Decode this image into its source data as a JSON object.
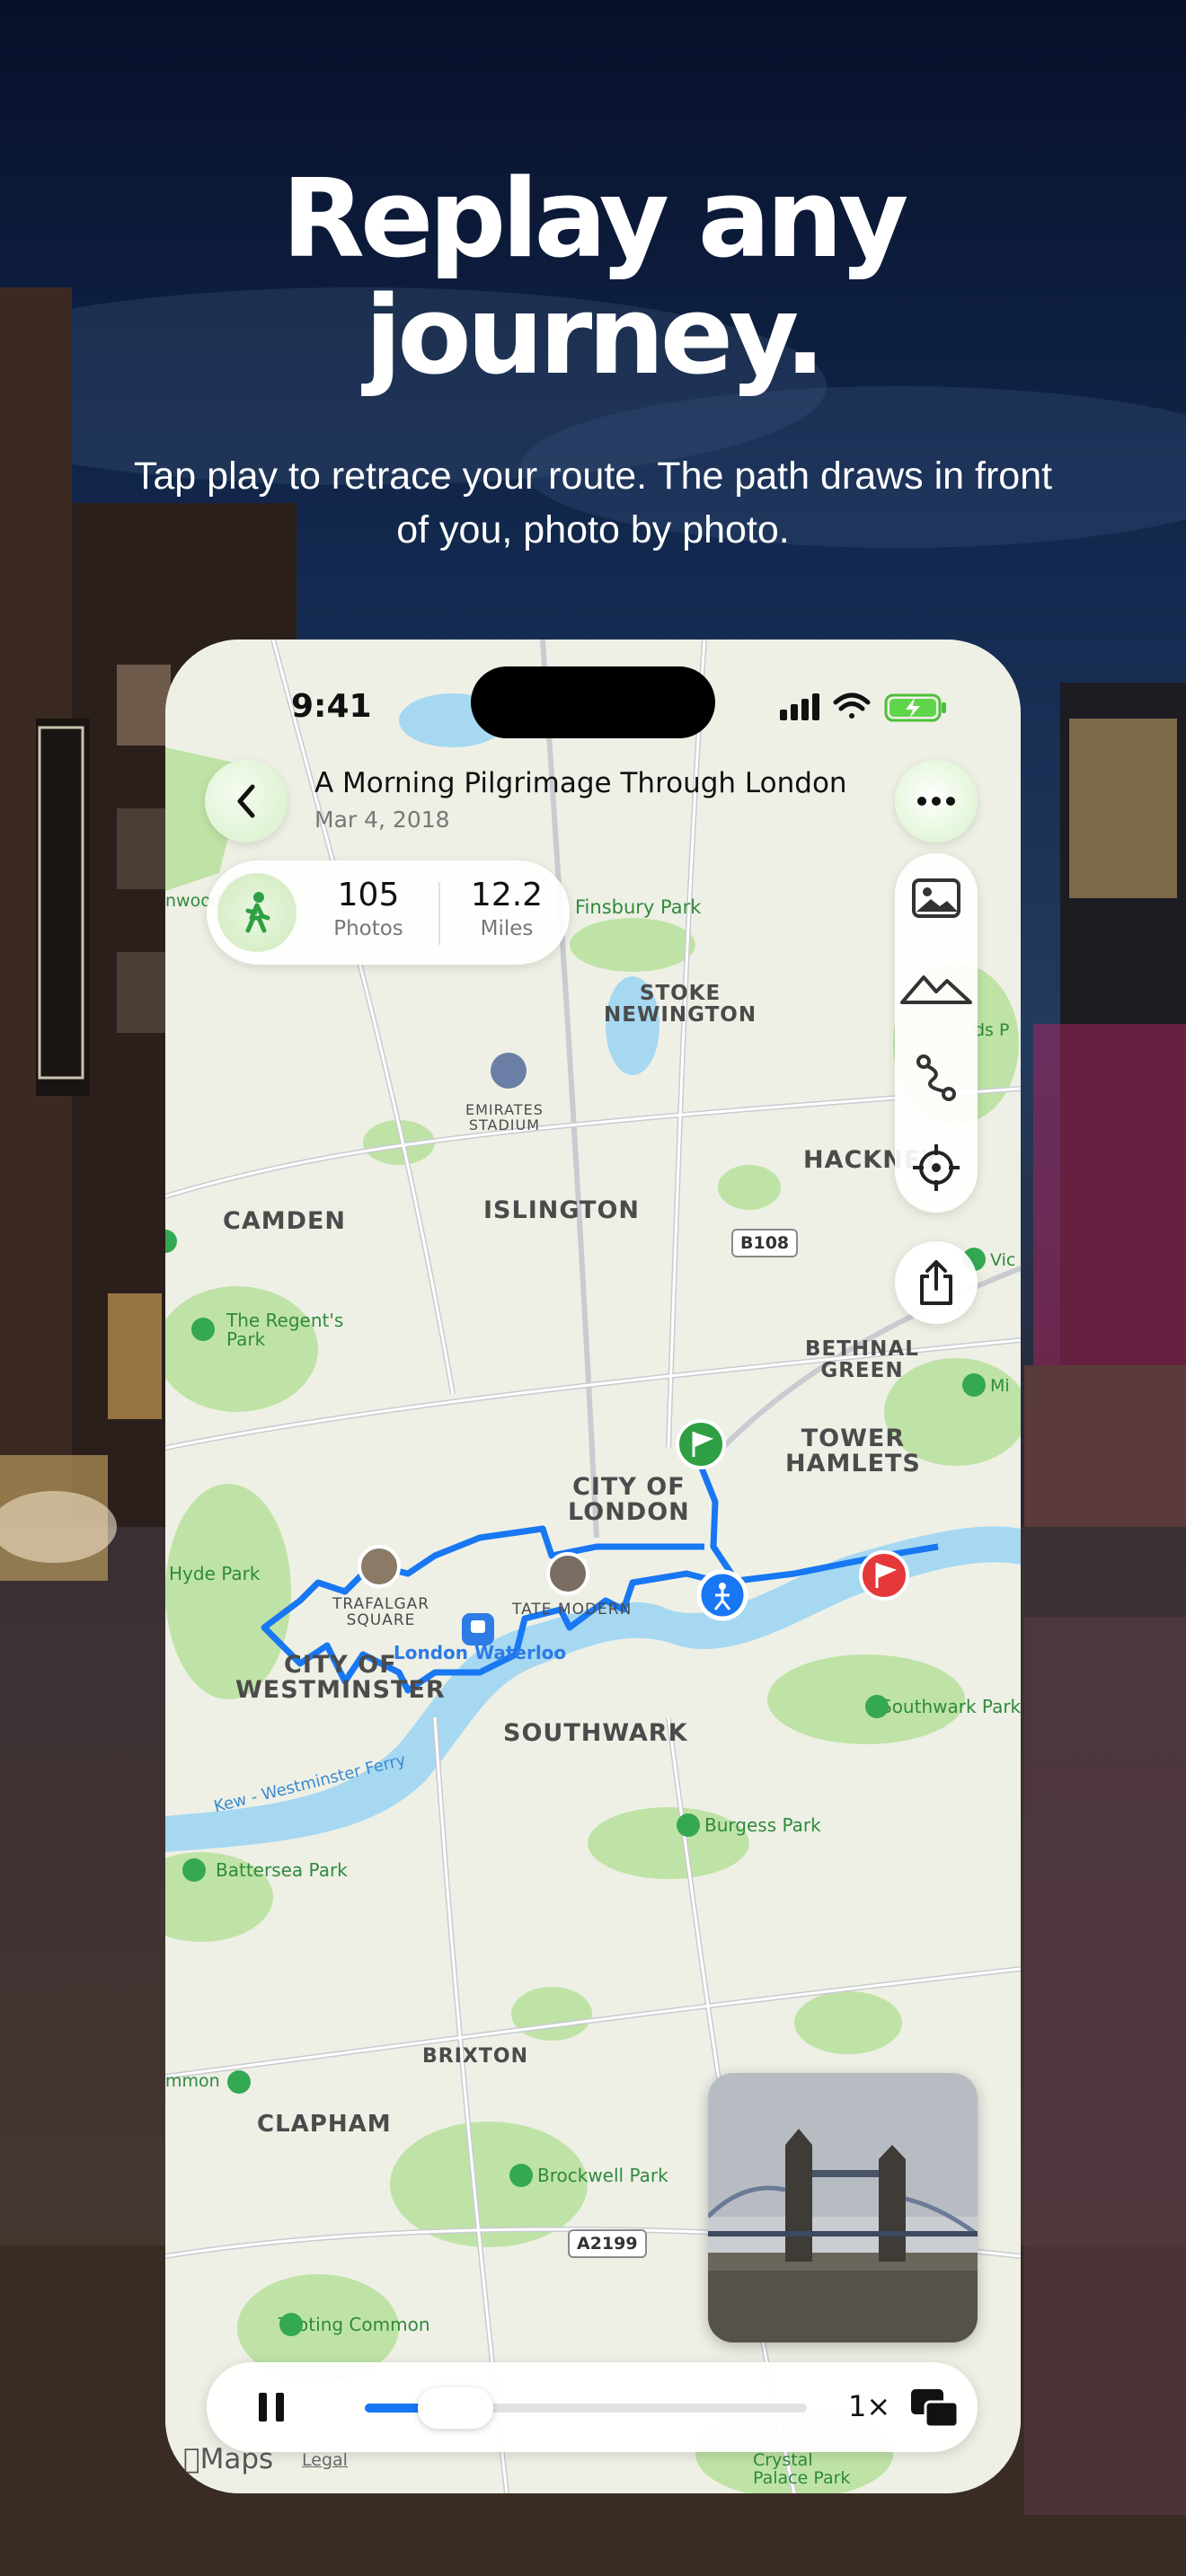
{
  "headline": {
    "line1": "Replay any",
    "line2": "journey."
  },
  "subhead": {
    "line1": "Tap play to retrace your route. The path draws in front",
    "line2": "of you, photo by photo."
  },
  "status_bar": {
    "time": "9:41"
  },
  "journey": {
    "title": "A Morning Pilgrimage Through London",
    "date": "Mar 4, 2018",
    "stats": [
      {
        "value": "105",
        "label": "Photos"
      },
      {
        "value": "12.2",
        "label": "Miles"
      }
    ]
  },
  "map": {
    "areas": [
      {
        "text": "STOKE\nNEWINGTON"
      },
      {
        "text": "HACKNEY"
      },
      {
        "text": "CAMDEN"
      },
      {
        "text": "ISLINGTON"
      },
      {
        "text": "BETHNAL\nGREEN"
      },
      {
        "text": "TOWER\nHAMLETS"
      },
      {
        "text": "CITY OF\nLONDON"
      },
      {
        "text": "CITY OF\nWESTMINSTER"
      },
      {
        "text": "SOUTHWARK"
      },
      {
        "text": "BRIXTON"
      },
      {
        "text": "CLAPHAM"
      },
      {
        "text": "TRAFALGAR\nSQUARE"
      },
      {
        "text": "TATE MODERN"
      },
      {
        "text": "EMIRATES\nSTADIUM"
      }
    ],
    "parks": [
      {
        "text": "Finsbury Park"
      },
      {
        "text": "The Regent's\nPark"
      },
      {
        "text": "Hyde Park"
      },
      {
        "text": "Southwark Park"
      },
      {
        "text": "Burgess Park"
      },
      {
        "text": "Battersea Park"
      },
      {
        "text": "Brockwell Park"
      },
      {
        "text": "Tooting Common"
      },
      {
        "text": "Crystal\nPalace Park"
      },
      {
        "text": "nwood"
      },
      {
        "text": "ds P"
      },
      {
        "text": "Vic"
      },
      {
        "text": "Mi"
      },
      {
        "text": "mmon"
      }
    ],
    "stations": [
      {
        "text": "London Waterloo"
      }
    ],
    "roads": [
      {
        "text": "B108"
      },
      {
        "text": "A2199"
      }
    ],
    "river_label": "Kew - Westminster Ferry"
  },
  "player": {
    "speed": "1×",
    "progress": 0.12
  },
  "footer": {
    "maps_brand": "Maps",
    "legal": "Legal"
  },
  "colors": {
    "route": "#1877f2",
    "start_pin": "#2ea043",
    "end_pin": "#e5383b",
    "accent_green": "#2f8a3c"
  },
  "icons": [
    "chevron-left-icon",
    "more-icon",
    "walking-icon",
    "photo-icon",
    "mountain-icon",
    "route-icon",
    "crosshair-icon",
    "share-icon",
    "pause-icon",
    "picture-in-picture-icon",
    "flag-icon",
    "train-icon",
    "stadium-icon",
    "tree-icon"
  ]
}
